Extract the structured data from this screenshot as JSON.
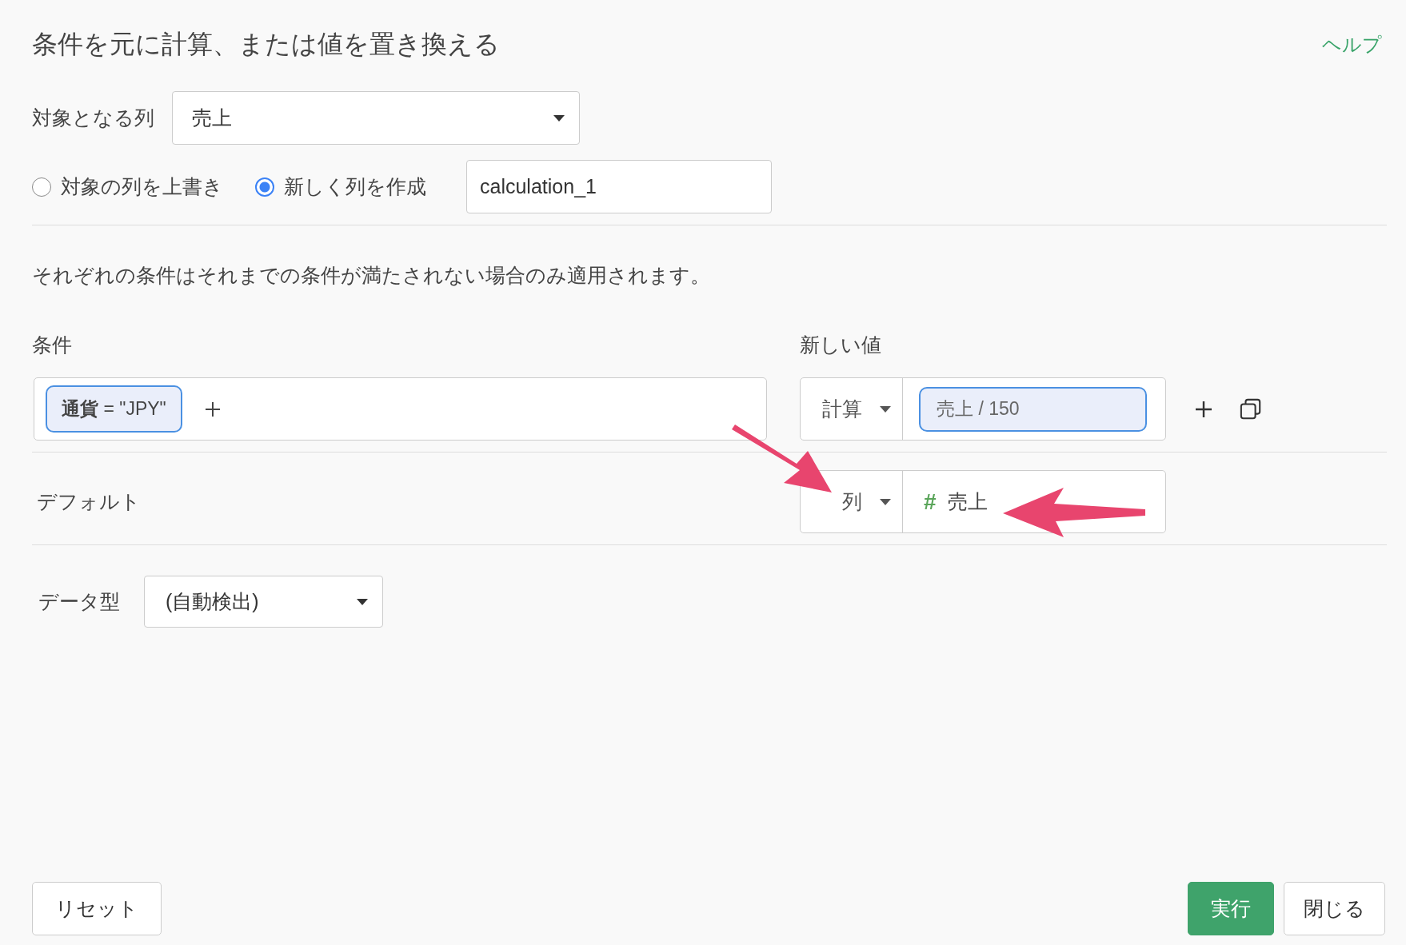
{
  "title": "条件を元に計算、または値を置き換える",
  "help_link": "ヘルプ",
  "target_column": {
    "label": "対象となる列",
    "value": "売上"
  },
  "write_mode": {
    "options": [
      {
        "label": "対象の列を上書き",
        "selected": false
      },
      {
        "label": "新しく列を作成",
        "selected": true
      }
    ],
    "new_column_name": "calculation_1"
  },
  "note": "それぞれの条件はそれまでの条件が満たされない場合のみ適用されます。",
  "conditions": {
    "condition_header": "条件",
    "value_header": "新しい値",
    "rows": [
      {
        "chips": [
          "**通貨** = \"JPY\""
        ],
        "value_type": "計算",
        "value": "売上 / 150"
      }
    ]
  },
  "default": {
    "label": "デフォルト",
    "value_type": "列",
    "type_icon": "#",
    "value": "売上"
  },
  "data_type": {
    "label": "データ型",
    "value": "(自動検出)"
  },
  "buttons": {
    "reset": "リセット",
    "run": "実行",
    "close": "閉じる"
  }
}
